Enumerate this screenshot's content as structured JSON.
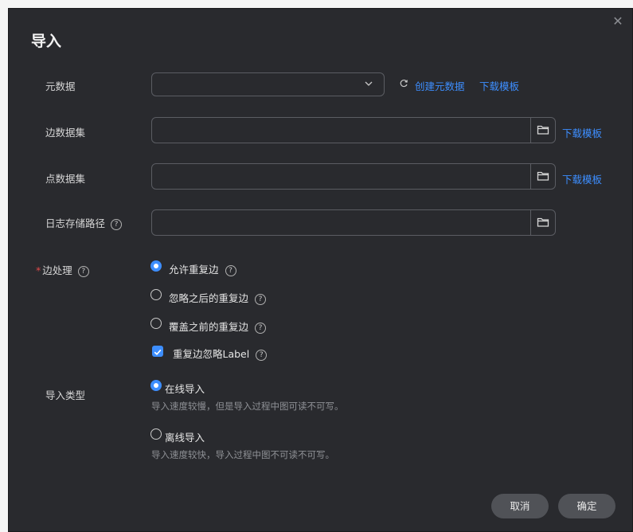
{
  "dialog": {
    "title": "导入",
    "close_icon": "close-icon"
  },
  "form": {
    "metadata": {
      "label": "元数据",
      "value": "",
      "refresh_icon": "refresh-icon",
      "create_link": "创建元数据",
      "download_link": "下载模板"
    },
    "edge_dataset": {
      "label": "边数据集",
      "value": "",
      "download_link": "下载模板"
    },
    "vertex_dataset": {
      "label": "点数据集",
      "value": "",
      "download_link": "下载模板"
    },
    "log_path": {
      "label": "日志存储路径",
      "help": "?",
      "value": ""
    },
    "edge_handling": {
      "required_mark": "*",
      "label": "边处理",
      "help": "?",
      "options": [
        {
          "label": "允许重复边",
          "selected": true
        },
        {
          "label": "忽略之后的重复边",
          "selected": false
        },
        {
          "label": "覆盖之前的重复边",
          "selected": false
        }
      ],
      "ignore_label_checkbox": {
        "label": "重复边忽略Label",
        "checked": true
      }
    },
    "import_type": {
      "label": "导入类型",
      "options": [
        {
          "label": "在线导入",
          "hint": "导入速度较慢，但是导入过程中图可读不可写。",
          "selected": true
        },
        {
          "label": "离线导入",
          "hint": "导入速度较快，导入过程中图不可读不可写。",
          "selected": false
        }
      ]
    }
  },
  "footer": {
    "cancel": "取消",
    "confirm": "确定"
  },
  "colors": {
    "background": "#292a2e",
    "accent": "#3d8eff",
    "required": "#e04a4a",
    "button": "#505257"
  }
}
